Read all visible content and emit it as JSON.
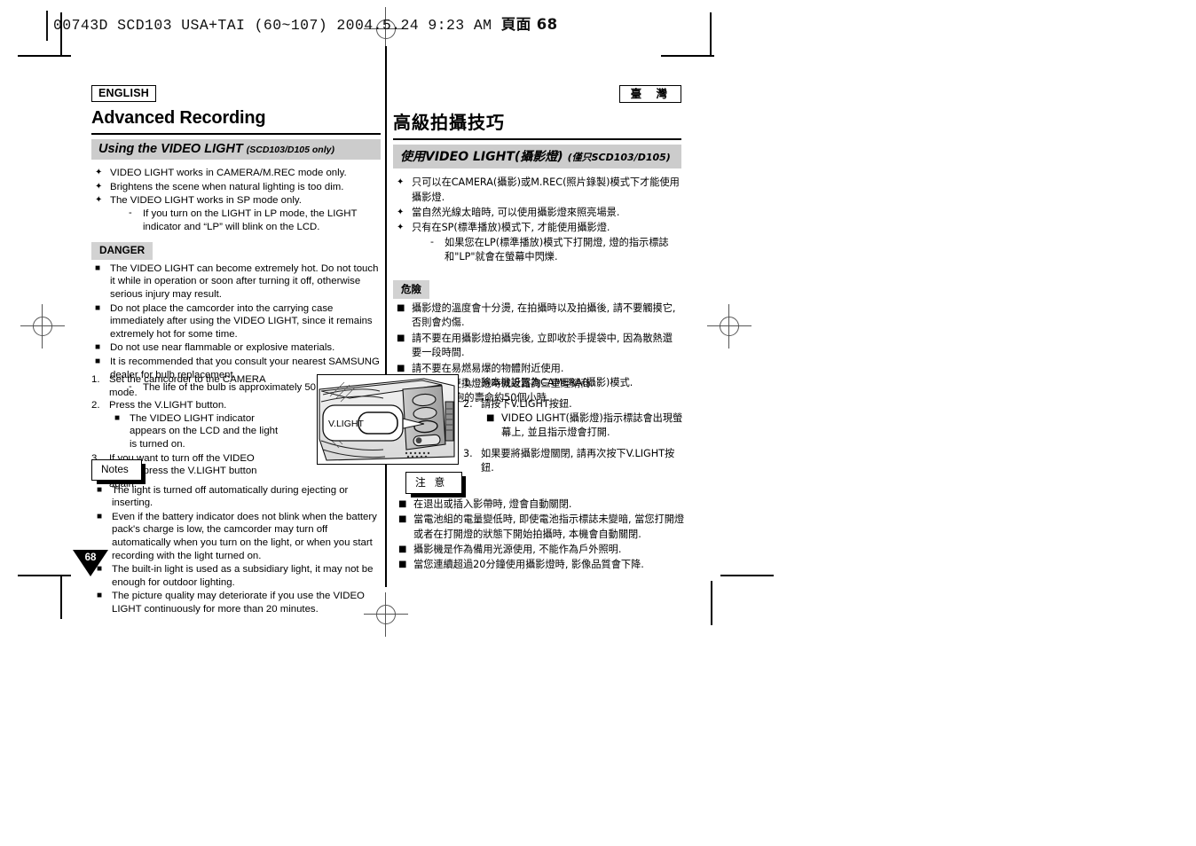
{
  "slug": {
    "text": "00743D SCD103 USA+TAI (60~107)  2004.5.24  9:23 AM",
    "page_label": "頁面 68"
  },
  "page_number": "68",
  "left_column": {
    "language_badge": "ENGLISH",
    "chapter_title": "Advanced Recording",
    "section_title": "Using the VIDEO LIGHT",
    "section_title_note": "(SCD103/D105 only)",
    "intro_bullets": [
      "VIDEO LIGHT works in CAMERA/M.REC mode only.",
      "Brightens the scene when natural lighting is too dim.",
      "The VIDEO LIGHT works in SP mode only."
    ],
    "intro_sub_bullets": [
      "If you turn on the LIGHT in LP mode, the LIGHT indicator and “LP”  will blink on the LCD."
    ],
    "danger_label": "DANGER",
    "danger_bullets": [
      "The VIDEO LIGHT can become extremely hot. Do not touch it while in operation or soon after turning it off, otherwise serious injury may result.",
      "Do not place the camcorder into the carrying case immediately after using the VIDEO LIGHT, since it remains extremely hot for some time.",
      "Do not use near flammable or explosive materials.",
      "It is recommended that you consult your nearest SAMSUNG dealer for bulb replacement."
    ],
    "danger_sub_bullets": [
      "The life of the bulb is approximately 50 hours."
    ],
    "steps": [
      {
        "num": "1.",
        "text": "Set the camcorder to the CAMERA mode.",
        "sub": []
      },
      {
        "num": "2.",
        "text": "Press the V.LIGHT button.",
        "sub": [
          "The VIDEO LIGHT indicator appears on the LCD and the light is turned on."
        ]
      },
      {
        "num": "3.",
        "text": "If you want to turn off the VIDEO LIGHT, press the V.LIGHT button again.",
        "sub": []
      }
    ],
    "notes_label": "Notes",
    "notes_bullets": [
      "The light is turned off automatically during ejecting or inserting.",
      "Even if the battery indicator does not blink when the battery pack's charge is low, the camcorder may turn off automatically when you turn on the light, or when you start recording with the light turned on.",
      "The built-in light is used as a subsidiary light, it may not be enough for outdoor lighting.",
      "The picture quality may deteriorate if you use the VIDEO LIGHT continuously for more than 20 minutes."
    ]
  },
  "right_column": {
    "language_badge": "臺 灣",
    "chapter_title": "高級拍攝技巧",
    "section_title": "使用VIDEO LIGHT(攝影燈)",
    "section_title_note": "(僅只SCD103/D105)",
    "intro_bullets": [
      "只可以在CAMERA(攝影)或M.REC(照片錄製)模式下才能使用攝影燈.",
      "當自然光線太暗時, 可以使用攝影燈來照亮場景.",
      "只有在SP(標準播放)模式下, 才能使用攝影燈."
    ],
    "intro_sub_bullets": [
      "如果您在LP(標準播放)模式下打開燈, 燈的指示標誌和\"LP\"就會在螢幕中閃爍."
    ],
    "danger_label": "危險",
    "danger_bullets": [
      "攝影燈的溫度會十分燙, 在拍攝時以及拍攝後, 請不要觸摸它, 否則會灼傷.",
      "請不要在用攝影燈拍攝完後, 立即收於手提袋中, 因為散熱還要一段時間.",
      "請不要在易燃易爆的物體附近使用.",
      "建議您要更換燈泡時就近諮詢三星經銷商."
    ],
    "danger_sub_bullets": [
      "燈泡的壽命約50個小時."
    ],
    "steps": [
      {
        "num": "1.",
        "text": "將本機設置為CAMERA(攝影)模式.",
        "sub": []
      },
      {
        "num": "2.",
        "text": "請按下V.LIGHT按鈕.",
        "sub": [
          "VIDEO LIGHT(攝影燈)指示標誌會出現螢幕上, 並且指示燈會打開."
        ]
      },
      {
        "num": "3.",
        "text": "如果要將攝影燈關閉, 請再次按下V.LIGHT按鈕.",
        "sub": []
      }
    ],
    "notes_label": "注 意",
    "notes_bullets": [
      "在退出或插入影帶時, 燈會自動關閉.",
      "當電池組的電量變低時, 即使電池指示標誌未變暗, 當您打開燈或者在打開燈的狀態下開始拍攝時, 本機會自動關閉.",
      "攝影機是作為備用光源使用, 不能作為戶外照明.",
      "當您連續超過20分鐘使用攝影燈時, 影像品質會下降."
    ]
  },
  "illustration": {
    "callout_label": "V.LIGHT"
  },
  "bullets": {
    "flower": "✦",
    "square": "■",
    "dash": "-"
  },
  "colors": {
    "section_bar": "#cccccc",
    "tag_bar": "#d2d2d2",
    "ink": "#000000"
  }
}
